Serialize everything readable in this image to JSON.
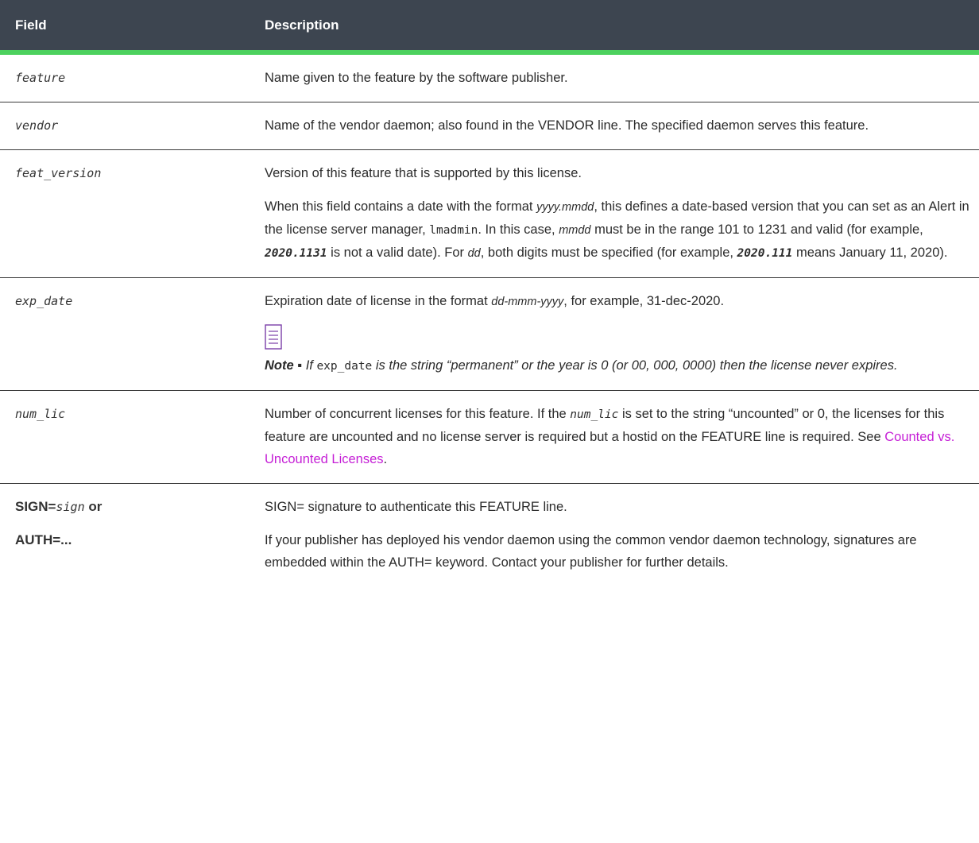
{
  "header": {
    "field": "Field",
    "description": "Description"
  },
  "rows": {
    "feature": {
      "field": "feature",
      "desc": "Name given to the feature by the software publisher."
    },
    "vendor": {
      "field": "vendor",
      "desc": "Name of the vendor daemon; also found in the VENDOR line. The specified daemon serves this feature."
    },
    "feat_version": {
      "field": "feat_version",
      "desc1": "Version of this feature that is supported by this license.",
      "p2_a": "When this field contains a date with the format ",
      "p2_fmt": "yyyy.mmdd",
      "p2_b": ", this defines a date-based version that you can set as an Alert in the license server manager, ",
      "p2_code": "lmadmin",
      "p2_c": ". In this case, ",
      "p2_mmdd": "mmdd",
      "p2_d": "  must be in the range 101 to 1231 and valid (for example, ",
      "p2_ex1": "2020.1131",
      "p2_e": " is not a valid date). For ",
      "p2_dd": "dd",
      "p2_f": ", both digits must be specified (for example, ",
      "p2_ex2": "2020.111",
      "p2_g": "  means January 11, 2020)."
    },
    "exp_date": {
      "field": "exp_date",
      "d_a": "Expiration date of license in the format ",
      "d_fmt": "dd-mmm-yyyy",
      "d_b": ", for example, 31-dec-2020.",
      "note_label": "Note ▪",
      "note_a": " If ",
      "note_code": "exp_date",
      "note_b": " is the string “permanent” or the year is 0 (or 00, 000, 0000) then the license never expires."
    },
    "num_lic": {
      "field": "num_lic",
      "d_a": "Number of concurrent licenses for this feature. If the ",
      "d_code": "num_lic",
      "d_b": " is set to the string “uncounted” or 0, the licenses for this feature are uncounted and no license server is required but a hostid on the FEATURE line is required. See ",
      "d_link": "Counted vs. Uncounted Licenses",
      "d_c": "."
    },
    "sign": {
      "f1_a": "SIGN=",
      "f1_b": "sign",
      "f1_c": " or",
      "f2": "AUTH=...",
      "desc1": "SIGN= signature to authenticate this FEATURE line.",
      "desc2": "If your publisher has deployed his vendor daemon using the common vendor daemon technology, signatures are embedded within the AUTH= keyword. Contact your publisher for further details."
    }
  },
  "colors": {
    "header_bg": "#3d4550",
    "header_rule": "#4cd15e",
    "link": "#c51fd6"
  },
  "icons": {
    "note": "note-icon"
  }
}
